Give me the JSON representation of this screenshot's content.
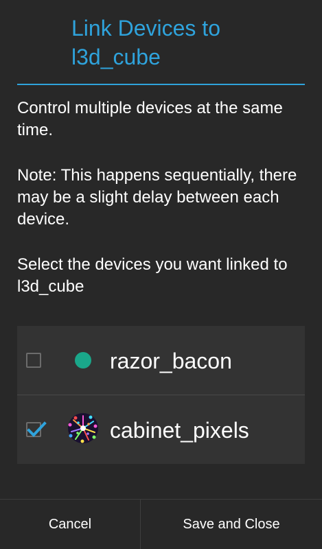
{
  "dialog": {
    "title_line1": "Link Devices to",
    "title_line2": "l3d_cube",
    "description": "Control multiple devices at the same time.",
    "note": "Note: This happens sequentially, there may be a slight delay between each device.",
    "instruction": "Select the devices you want linked to l3d_cube"
  },
  "devices": [
    {
      "name": "razor_bacon",
      "checked": false,
      "icon": "status-dot-icon",
      "status_color": "#1aa78a"
    },
    {
      "name": "cabinet_pixels",
      "checked": true,
      "icon": "sparkle-avatar-icon"
    }
  ],
  "buttons": {
    "cancel": "Cancel",
    "save": "Save and Close"
  },
  "colors": {
    "accent": "#2fa3dc",
    "background": "#282828",
    "list_background": "#333333",
    "online": "#1aa78a"
  }
}
